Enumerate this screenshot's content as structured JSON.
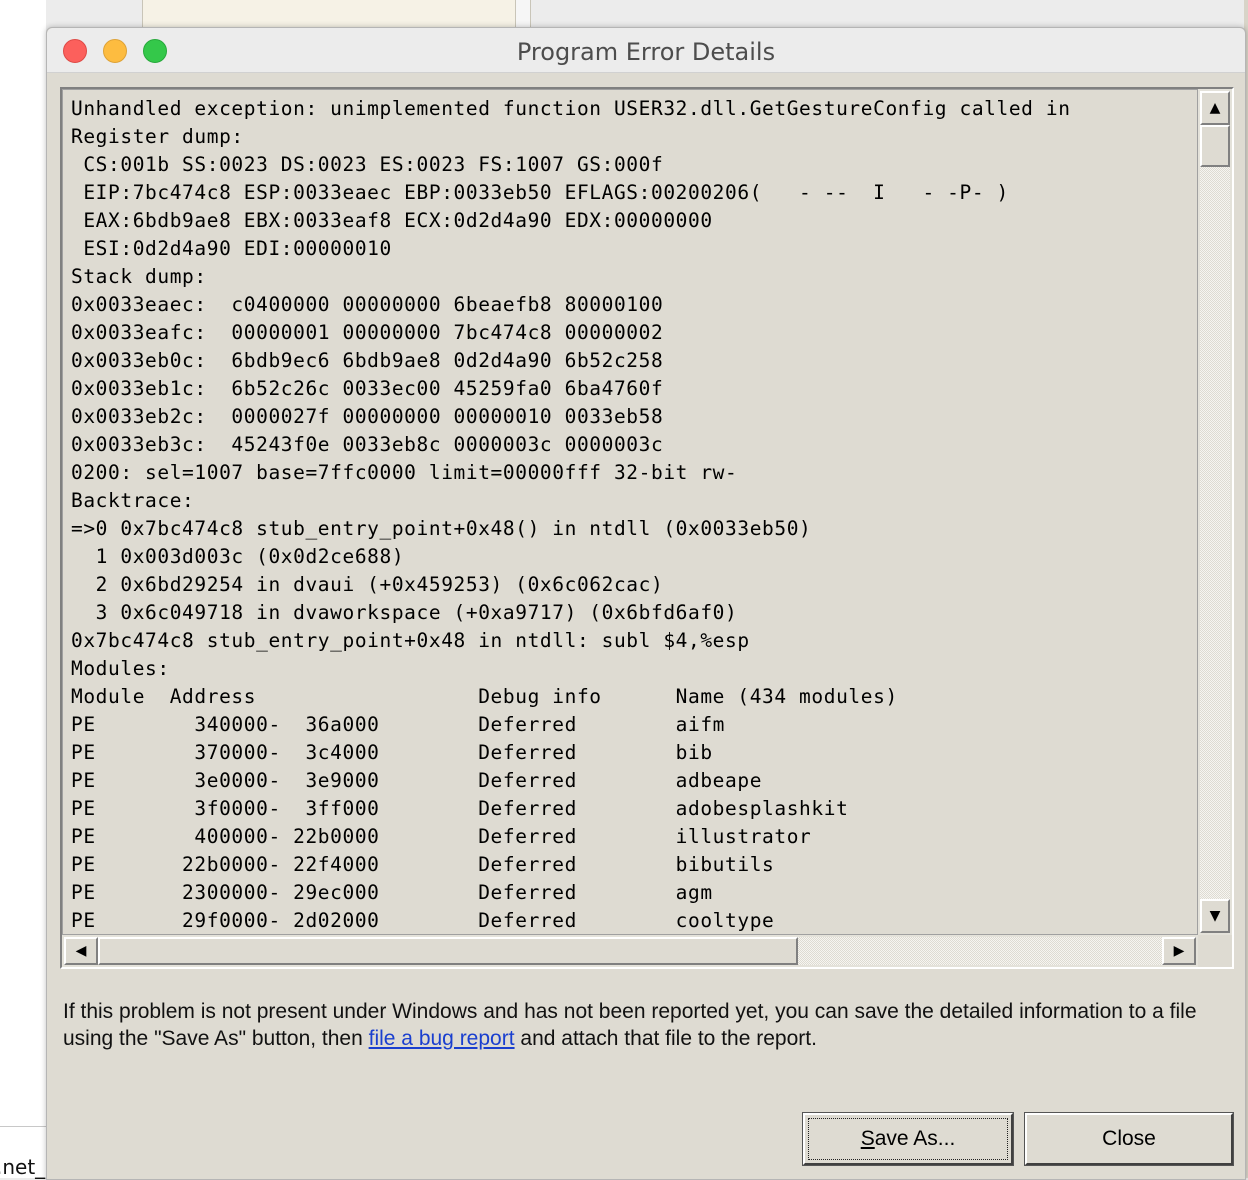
{
  "background": {
    "left_text": ".net_"
  },
  "window": {
    "title": "Program Error Details"
  },
  "log": {
    "lines": [
      "Unhandled exception: unimplemented function USER32.dll.GetGestureConfig called in",
      "Register dump:",
      " CS:001b SS:0023 DS:0023 ES:0023 FS:1007 GS:000f",
      " EIP:7bc474c8 ESP:0033eaec EBP:0033eb50 EFLAGS:00200206(   - --  I   - -P- )",
      " EAX:6bdb9ae8 EBX:0033eaf8 ECX:0d2d4a90 EDX:00000000",
      " ESI:0d2d4a90 EDI:00000010",
      "Stack dump:",
      "0x0033eaec:  c0400000 00000000 6beaefb8 80000100",
      "0x0033eafc:  00000001 00000000 7bc474c8 00000002",
      "0x0033eb0c:  6bdb9ec6 6bdb9ae8 0d2d4a90 6b52c258",
      "0x0033eb1c:  6b52c26c 0033ec00 45259fa0 6ba4760f",
      "0x0033eb2c:  0000027f 00000000 00000010 0033eb58",
      "0x0033eb3c:  45243f0e 0033eb8c 0000003c 0000003c",
      "0200: sel=1007 base=7ffc0000 limit=00000fff 32-bit rw-",
      "Backtrace:",
      "=>0 0x7bc474c8 stub_entry_point+0x48() in ntdll (0x0033eb50)",
      "  1 0x003d003c (0x0d2ce688)",
      "  2 0x6bd29254 in dvaui (+0x459253) (0x6c062cac)",
      "  3 0x6c049718 in dvaworkspace (+0xa9717) (0x6bfd6af0)",
      "0x7bc474c8 stub_entry_point+0x48 in ntdll: subl $4,%esp",
      "Modules:",
      "Module  Address                  Debug info      Name (434 modules)",
      "PE        340000-  36a000        Deferred        aifm",
      "PE        370000-  3c4000        Deferred        bib",
      "PE        3e0000-  3e9000        Deferred        adbeape",
      "PE        3f0000-  3ff000        Deferred        adobesplashkit",
      "PE        400000- 22b0000        Deferred        illustrator",
      "PE       22b0000- 22f4000        Deferred        bibutils",
      "PE       2300000- 29ec000        Deferred        agm",
      "PE       29f0000- 2d02000        Deferred        cooltype"
    ]
  },
  "message": {
    "text_before_link": "If this problem is not present under Windows and has not been reported yet, you can save the detailed information to a file using the \"Save As\" button, then ",
    "link_text": "file a bug report",
    "text_after_link": " and attach that file to the report."
  },
  "buttons": {
    "save_as": "Save As...",
    "close": "Close"
  },
  "icons": {
    "scroll_up": "▲",
    "scroll_down": "▼",
    "scroll_left": "◀",
    "scroll_right": "▶"
  },
  "colors": {
    "traffic_close": "#fc605c",
    "traffic_minimize": "#fdbc40",
    "traffic_zoom": "#34c84a",
    "link": "#1a3fcf",
    "dialog_bg": "#dedbd2"
  }
}
